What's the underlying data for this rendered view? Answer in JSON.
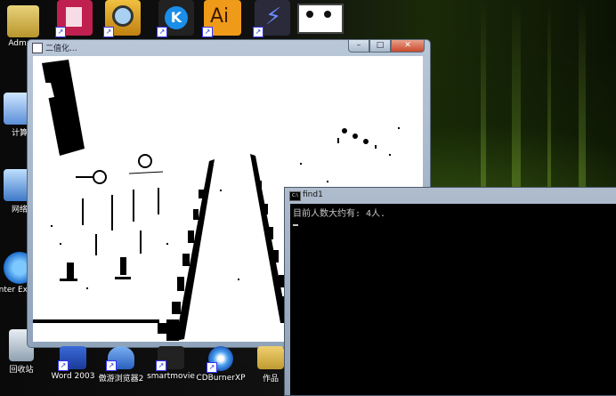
{
  "desktop": {
    "icons_left": [
      {
        "name": "Admin-folder",
        "label": "Admnis"
      },
      {
        "name": "computer",
        "label": "计算"
      },
      {
        "name": "network",
        "label": "网络"
      },
      {
        "name": "internet-explorer",
        "label": "Inter Explor"
      },
      {
        "name": "recycle-bin",
        "label": "回收站"
      }
    ],
    "icons_top": [
      {
        "name": "ppt-icon",
        "label": ""
      },
      {
        "name": "search-tool-icon",
        "label": ""
      },
      {
        "name": "kugou-icon",
        "label": ""
      },
      {
        "name": "illustrator-icon",
        "label": "Ai"
      },
      {
        "name": "flash-icon",
        "label": ""
      },
      {
        "name": "image-thumb-icon",
        "label": ""
      }
    ],
    "icons_bottom": [
      {
        "name": "word-2003",
        "label": "Word 2003"
      },
      {
        "name": "maxthon",
        "label": "傲游浏览器2"
      },
      {
        "name": "smartmovie",
        "label": "smartmovie"
      },
      {
        "name": "cdburnerxp",
        "label": "CDBurnerXP"
      },
      {
        "name": "works-folder",
        "label": "作品"
      }
    ]
  },
  "image_window": {
    "title": "二值化..."
  },
  "console_window": {
    "title": "find1",
    "output": "目前人数大约有: 4人.",
    "controls": {
      "minimize": "–",
      "maximize": "□",
      "close": "✕"
    }
  }
}
